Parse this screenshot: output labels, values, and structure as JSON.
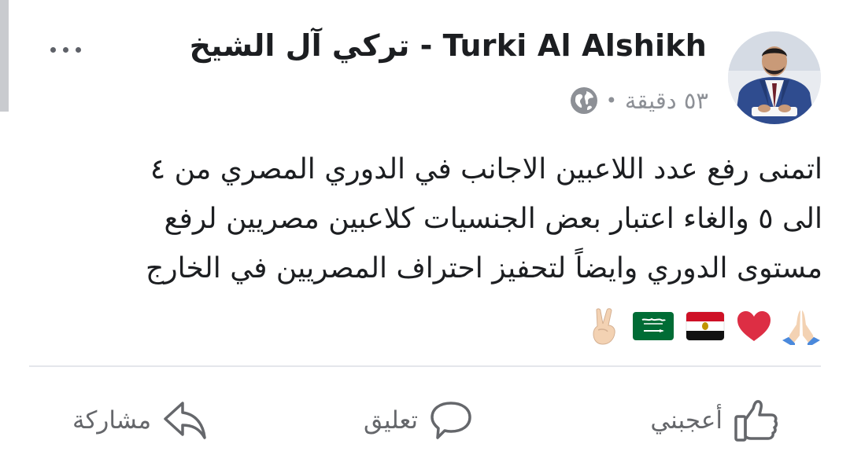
{
  "post": {
    "author_name": "تركي آل الشيخ - Turki Al Alshikh",
    "timestamp": "٥٣ دقيقة",
    "separator": "•",
    "privacy_icon": "globe-icon",
    "more_icon": "more-horizontal-icon",
    "body_lines": [
      "اتمنى رفع عدد اللاعبين  الاجانب في الدوري المصري من ٤",
      "الى ٥ والغاء اعتبار بعض الجنسيات كلاعبين مصريين لرفع",
      "مستوى الدوري وايضاً لتحفيز احتراف المصريين في الخارج"
    ],
    "emojis": [
      "folded-hands-emoji",
      "red-heart-emoji",
      "egypt-flag-emoji",
      "saudi-flag-emoji",
      "victory-hand-emoji"
    ]
  },
  "actions": {
    "like_label": "أعجبني",
    "comment_label": "تعليق",
    "share_label": "مشاركة",
    "like_icon": "thumbs-up-icon",
    "comment_icon": "comment-bubble-icon",
    "share_icon": "share-arrow-icon"
  },
  "colors": {
    "text_primary": "#1c1e21",
    "text_secondary": "#65676b",
    "meta_gray": "#8d9096",
    "divider": "#e4e6eb"
  }
}
